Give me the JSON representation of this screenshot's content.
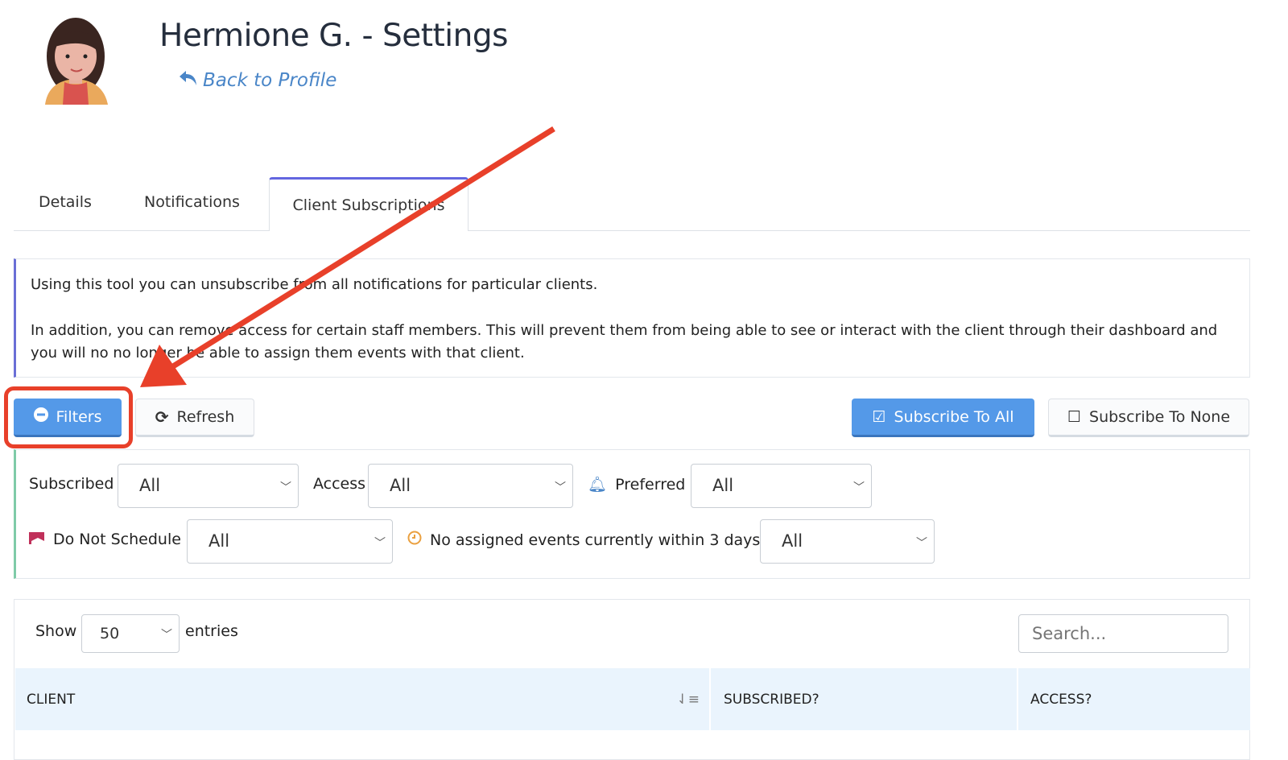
{
  "header": {
    "title": "Hermione G. - Settings",
    "back_link": "Back to Profile"
  },
  "tabs": [
    {
      "label": "Details"
    },
    {
      "label": "Notifications"
    },
    {
      "label": "Client Subscriptions",
      "active": true
    }
  ],
  "info": {
    "line1": "Using this tool you can unsubscribe from all notifications for particular clients.",
    "line2": "In addition, you can remove access for certain staff members. This will prevent them from being able to see or interact with the client through their dashboard and you will no no longer be able to assign them events with that client."
  },
  "toolbar": {
    "filters": "Filters",
    "refresh": "Refresh",
    "subscribe_all": "Subscribe To All",
    "subscribe_none": "Subscribe To None"
  },
  "filters": {
    "subscribed": {
      "label": "Subscribed",
      "value": "All"
    },
    "access": {
      "label": "Access",
      "value": "All"
    },
    "preferred": {
      "label": "Preferred",
      "value": "All"
    },
    "do_not_schedule": {
      "label": "Do Not Schedule",
      "value": "All"
    },
    "no_events": {
      "label": "No assigned events currently within 3 days",
      "value": "All"
    }
  },
  "table": {
    "show_label": "Show",
    "entries_value": "50",
    "entries_label": "entries",
    "search_placeholder": "Search...",
    "columns": [
      "CLIENT",
      "SUBSCRIBED?",
      "ACCESS?"
    ]
  },
  "colors": {
    "accent": "#5499e8",
    "tab_active": "#6366e0",
    "annotation": "#e8402a",
    "filter_border": "#7fcba8"
  }
}
